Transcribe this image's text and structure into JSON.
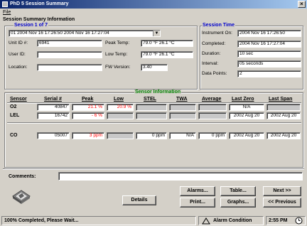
{
  "window": {
    "title": "PhD 5 Session Summary",
    "close_glyph": "×"
  },
  "menu": {
    "file": "File"
  },
  "summary": {
    "section_title": "Session Summary Information",
    "session_label": "Session 1 of 7",
    "session_select": "01  2004 Nov 16 17:26:50  2004 Nov 16 17:27:04",
    "unit_id_label": "Unit ID #:",
    "unit_id": "6941",
    "user_id_label": "User ID:",
    "user_id": "",
    "location_label": "Location:",
    "location": "",
    "peak_temp_label": "Peak Temp:",
    "peak_temp": "79.0 °F  26.1 °C",
    "low_temp_label": "Low Temp:",
    "low_temp": "79.0 °F  26.1 °C",
    "fw_version_label": "FW Version:",
    "fw_version": "3.40"
  },
  "session_time": {
    "title": "Session Time",
    "instrument_on_label": "Instrument On:",
    "instrument_on": "2004 Nov 16 17:26:50",
    "completed_label": "Completed:",
    "completed": "2004 Nov 16 17:27:04",
    "duration_label": "Duration:",
    "duration": "10 sec",
    "interval_label": "Interval:",
    "interval": "05 seconds",
    "data_points_label": "Data Points:",
    "data_points": "2"
  },
  "sensor_info": {
    "title": "Sensor Information",
    "headers": [
      "Sensor",
      "Serial #",
      "Peak",
      "Low",
      "STEL",
      "TWA",
      "Average",
      "Last Zero",
      "Last Span"
    ],
    "rows": [
      {
        "sensor": "O2",
        "serial": "40847",
        "peak": "21.1 %",
        "low": "20.9 %",
        "stel": "",
        "twa": "",
        "average": "",
        "last_zero": "N/A",
        "last_span": ""
      },
      {
        "sensor": "LEL",
        "serial": "16742",
        "peak": "- 6 %",
        "low": "",
        "stel": "",
        "twa": "",
        "average": "",
        "last_zero": "2002 Aug 20",
        "last_span": "2002 Aug 20"
      },
      {
        "sensor": "CO",
        "serial": "05007",
        "peak": "3 ppm",
        "low": "",
        "stel": "0 ppm",
        "twa": "N/A",
        "average": "0 ppm",
        "last_zero": "2002 Aug 20",
        "last_span": "2002 Aug 20"
      }
    ]
  },
  "comments": {
    "label": "Comments:",
    "value": ""
  },
  "buttons": {
    "details": "Details",
    "alarms": "Alarms...",
    "print": "Print...",
    "table": "Table...",
    "graphs": "Graphs...",
    "next": "Next >>",
    "previous": "<< Previous"
  },
  "status": {
    "message": "100% Completed, Please Wait...",
    "alarm_condition": "Alarm Condition",
    "time": "2:55 PM"
  },
  "colors": {
    "peak_alarm": "#ff0000",
    "title_blue": "#0000cc",
    "sensor_green": "#008000"
  }
}
